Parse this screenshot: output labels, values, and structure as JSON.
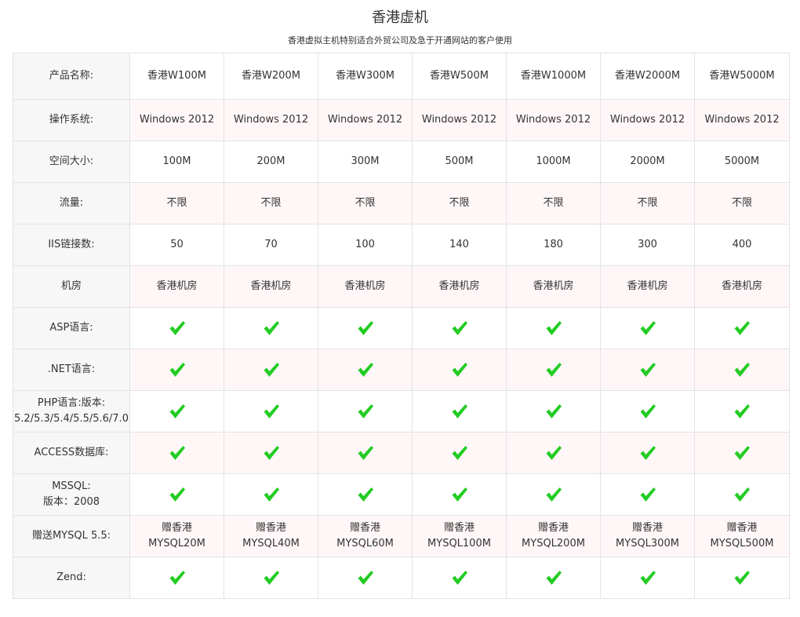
{
  "page": {
    "title": "香港虚机",
    "subtitle": "香港虚拟主机特别适合外贸公司及急于开通网站的客户使用"
  },
  "colors": {
    "check_green": "#22cc22",
    "label_bg": "#f7f7f7",
    "alt_row_bg": "#fff7f7",
    "border": "#e3e3e3"
  },
  "table": {
    "rows": [
      {
        "key": "product",
        "label": [
          "产品名称:"
        ],
        "type": "text",
        "alt": false,
        "first": true,
        "values": [
          [
            "香港W100M"
          ],
          [
            "香港W200M"
          ],
          [
            "香港W300M"
          ],
          [
            "香港W500M"
          ],
          [
            "香港W1000M"
          ],
          [
            "香港W2000M"
          ],
          [
            "香港W5000M"
          ]
        ]
      },
      {
        "key": "os",
        "label": [
          "操作系统:"
        ],
        "type": "text",
        "alt": true,
        "values": [
          [
            "Windows 2012"
          ],
          [
            "Windows 2012"
          ],
          [
            "Windows 2012"
          ],
          [
            "Windows 2012"
          ],
          [
            "Windows 2012"
          ],
          [
            "Windows 2012"
          ],
          [
            "Windows 2012"
          ]
        ]
      },
      {
        "key": "space",
        "label": [
          "空间大小:"
        ],
        "type": "text",
        "alt": false,
        "values": [
          [
            "100M"
          ],
          [
            "200M"
          ],
          [
            "300M"
          ],
          [
            "500M"
          ],
          [
            "1000M"
          ],
          [
            "2000M"
          ],
          [
            "5000M"
          ]
        ]
      },
      {
        "key": "traffic",
        "label": [
          "流量:"
        ],
        "type": "text",
        "alt": true,
        "values": [
          [
            "不限"
          ],
          [
            "不限"
          ],
          [
            "不限"
          ],
          [
            "不限"
          ],
          [
            "不限"
          ],
          [
            "不限"
          ],
          [
            "不限"
          ]
        ]
      },
      {
        "key": "iis",
        "label": [
          "IIS链接数:"
        ],
        "type": "text",
        "alt": false,
        "values": [
          [
            "50"
          ],
          [
            "70"
          ],
          [
            "100"
          ],
          [
            "140"
          ],
          [
            "180"
          ],
          [
            "300"
          ],
          [
            "400"
          ]
        ]
      },
      {
        "key": "datacenter",
        "label": [
          "机房"
        ],
        "type": "text",
        "alt": true,
        "values": [
          [
            "香港机房"
          ],
          [
            "香港机房"
          ],
          [
            "香港机房"
          ],
          [
            "香港机房"
          ],
          [
            "香港机房"
          ],
          [
            "香港机房"
          ],
          [
            "香港机房"
          ]
        ]
      },
      {
        "key": "asp",
        "label": [
          "ASP语言:"
        ],
        "type": "check",
        "alt": false,
        "values": [
          true,
          true,
          true,
          true,
          true,
          true,
          true
        ]
      },
      {
        "key": "dotnet",
        "label": [
          ".NET语言:"
        ],
        "type": "check",
        "alt": true,
        "values": [
          true,
          true,
          true,
          true,
          true,
          true,
          true
        ]
      },
      {
        "key": "php",
        "label": [
          "PHP语言:版本:",
          "5.2/5.3/5.4/5.5/5.6/7.0"
        ],
        "type": "check",
        "alt": false,
        "values": [
          true,
          true,
          true,
          true,
          true,
          true,
          true
        ]
      },
      {
        "key": "access",
        "label": [
          "ACCESS数据库:"
        ],
        "type": "check",
        "alt": true,
        "values": [
          true,
          true,
          true,
          true,
          true,
          true,
          true
        ]
      },
      {
        "key": "mssql",
        "label": [
          "MSSQL:",
          "版本：2008"
        ],
        "type": "check",
        "alt": false,
        "values": [
          true,
          true,
          true,
          true,
          true,
          true,
          true
        ]
      },
      {
        "key": "mysql",
        "label": [
          "赠送MYSQL 5.5:"
        ],
        "type": "text",
        "alt": true,
        "values": [
          [
            "赠香港",
            "MYSQL20M"
          ],
          [
            "赠香港",
            "MYSQL40M"
          ],
          [
            "赠香港",
            "MYSQL60M"
          ],
          [
            "赠香港",
            "MYSQL100M"
          ],
          [
            "赠香港",
            "MYSQL200M"
          ],
          [
            "赠香港",
            "MYSQL300M"
          ],
          [
            "赠香港",
            "MYSQL500M"
          ]
        ]
      },
      {
        "key": "zend",
        "label": [
          "Zend:"
        ],
        "type": "check",
        "alt": false,
        "values": [
          true,
          true,
          true,
          true,
          true,
          true,
          true
        ]
      }
    ]
  }
}
